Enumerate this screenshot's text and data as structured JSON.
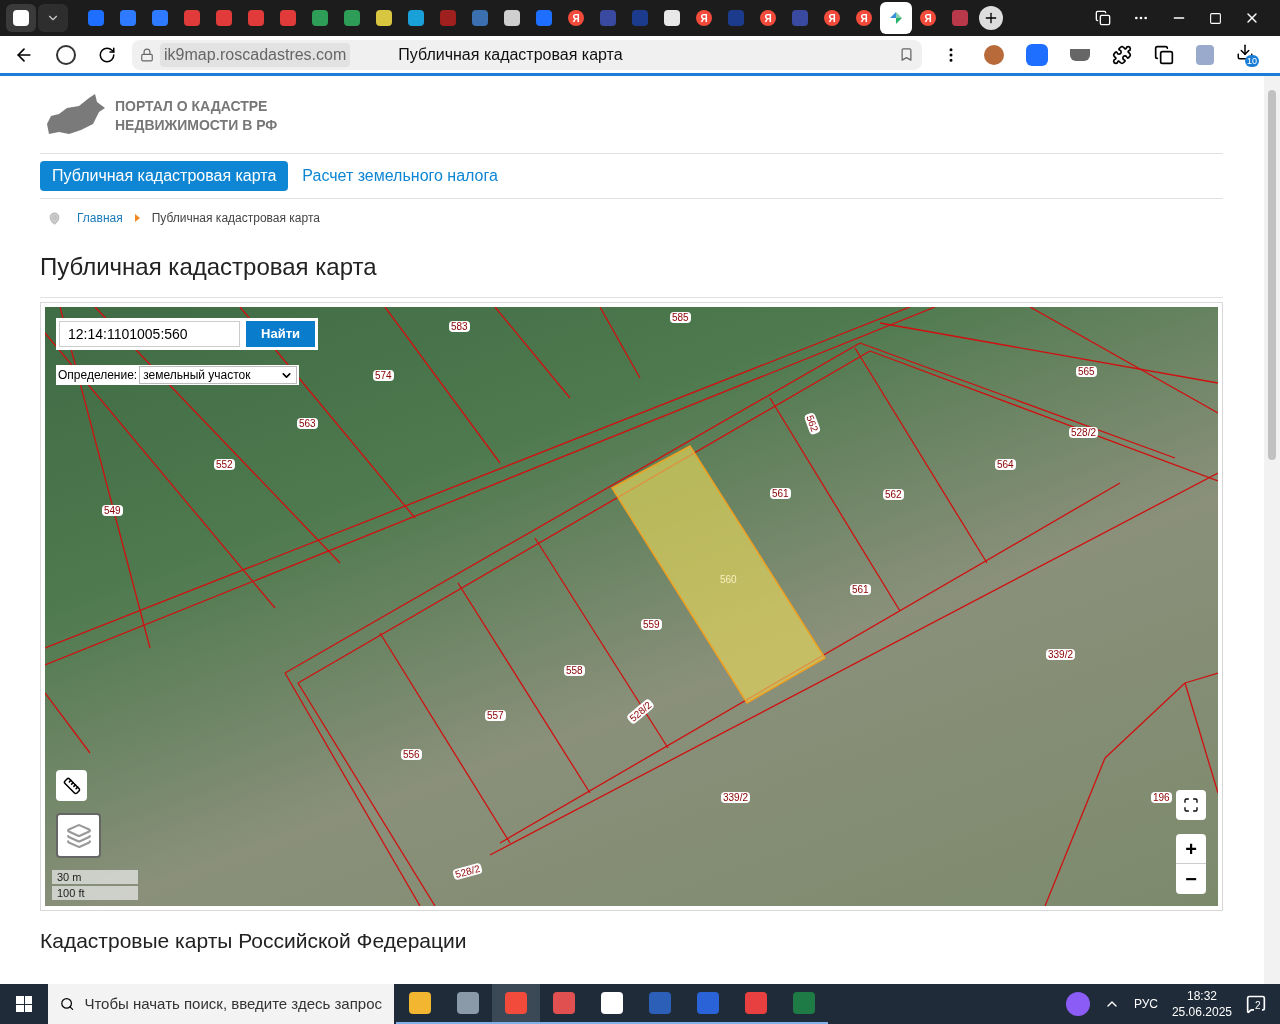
{
  "browser": {
    "tabs": [
      {
        "kind": "y",
        "selected": false
      },
      {
        "kind": "mail",
        "selected": false
      },
      {
        "kind": "mail",
        "selected": false
      },
      {
        "kind": "pdf",
        "selected": false
      },
      {
        "kind": "pdf",
        "selected": false
      },
      {
        "kind": "pdf",
        "selected": false
      },
      {
        "kind": "pdf",
        "selected": false
      },
      {
        "kind": "shield",
        "selected": false
      },
      {
        "kind": "shield",
        "selected": false
      },
      {
        "kind": "emblem",
        "selected": false
      },
      {
        "kind": "edge",
        "selected": false
      },
      {
        "kind": "ornament",
        "selected": false
      },
      {
        "kind": "globe",
        "selected": false
      },
      {
        "kind": "speaker",
        "selected": false
      },
      {
        "kind": "y",
        "selected": false
      },
      {
        "kind": "ya",
        "glyph": "Я",
        "selected": false
      },
      {
        "kind": "crest",
        "selected": false
      },
      {
        "kind": "eagle",
        "selected": false
      },
      {
        "kind": "doc",
        "selected": false
      },
      {
        "kind": "ya",
        "glyph": "Я",
        "selected": false
      },
      {
        "kind": "eagle",
        "selected": false
      },
      {
        "kind": "ya",
        "glyph": "Я",
        "selected": false
      },
      {
        "kind": "crest",
        "selected": false
      },
      {
        "kind": "ya",
        "glyph": "Я",
        "selected": false
      },
      {
        "kind": "ya",
        "glyph": "Я",
        "selected": false
      },
      {
        "kind": "map",
        "selected": true
      },
      {
        "kind": "ya",
        "glyph": "Я",
        "selected": false
      },
      {
        "kind": "wave",
        "selected": false
      }
    ],
    "address": "ik9map.roscadastres.com",
    "page_title": "Публичная кадастровая карта",
    "downloads_badge": "10"
  },
  "header": {
    "logo_lines": [
      "ПОРТАЛ О КАДАСТРЕ",
      "НЕДВИЖИМОСТИ В РФ"
    ]
  },
  "nav": [
    {
      "label": "Публичная кадастровая карта",
      "selected": true
    },
    {
      "label": "Расчет земельного налога",
      "selected": false
    }
  ],
  "breadcrumb": [
    {
      "label": "Главная"
    },
    {
      "label": "Публичная кадастровая карта"
    }
  ],
  "heading": "Публичная кадастровая карта",
  "map": {
    "search_value": "12:14:1101005:560",
    "search_button": "Найти",
    "definition_label": "Определение:",
    "definition_value": "земельный участок",
    "scale": [
      "30 m",
      "100 ft"
    ],
    "zoom_in": "+",
    "zoom_out": "−",
    "parcels": [
      {
        "label": "585",
        "selected": false
      },
      {
        "label": "583",
        "selected": false
      },
      {
        "label": "574",
        "selected": false
      },
      {
        "label": "563",
        "selected": false
      },
      {
        "label": "552",
        "selected": false
      },
      {
        "label": "549",
        "selected": false
      },
      {
        "label": "565",
        "selected": false
      },
      {
        "label": "562",
        "selected": false
      },
      {
        "label": "528/2",
        "selected": false
      },
      {
        "label": "564",
        "selected": false
      },
      {
        "label": "561",
        "selected": false
      },
      {
        "label": "562",
        "selected": false
      },
      {
        "label": "560",
        "selected": true
      },
      {
        "label": "561",
        "selected": false
      },
      {
        "label": "559",
        "selected": false
      },
      {
        "label": "558",
        "selected": false
      },
      {
        "label": "557",
        "selected": false
      },
      {
        "label": "556",
        "selected": false
      },
      {
        "label": "528/2",
        "selected": false
      },
      {
        "label": "339/2",
        "selected": false
      },
      {
        "label": "339/2",
        "selected": false
      },
      {
        "label": "196",
        "selected": false
      },
      {
        "label": "528/2",
        "selected": false
      }
    ]
  },
  "section_heading": "Кадастровые карты Российской Федерации",
  "taskbar": {
    "search_placeholder": "Чтобы начать поиск, введите здесь запрос",
    "apps": [
      {
        "kind": "folder",
        "selected": false
      },
      {
        "kind": "keyboard",
        "selected": false
      },
      {
        "kind": "yandex",
        "selected": true
      },
      {
        "kind": "shield",
        "selected": false
      },
      {
        "kind": "calc",
        "selected": false
      },
      {
        "kind": "word",
        "selected": false
      },
      {
        "kind": "c",
        "selected": false
      },
      {
        "kind": "remote",
        "selected": false
      },
      {
        "kind": "excel",
        "selected": false
      }
    ],
    "language": "РУС",
    "time": "18:32",
    "date": "25.06.2025",
    "notifications": "2"
  }
}
